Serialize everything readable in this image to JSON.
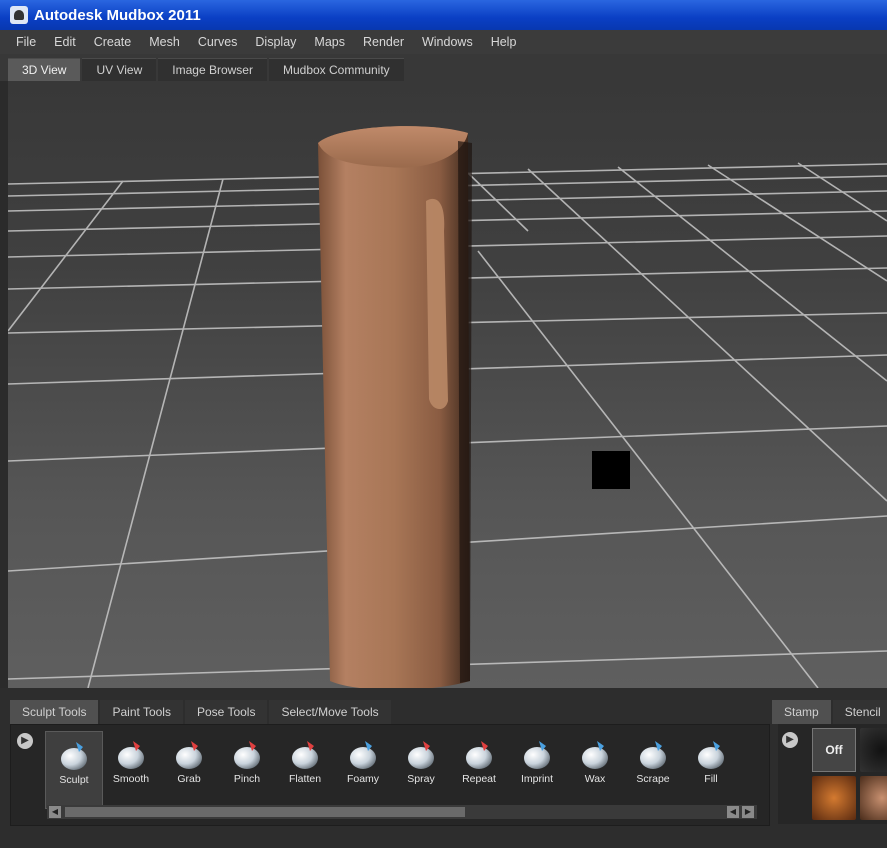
{
  "window": {
    "title": "Autodesk Mudbox 2011",
    "icon": "mudbox-app-icon"
  },
  "menu": [
    "File",
    "Edit",
    "Create",
    "Mesh",
    "Curves",
    "Display",
    "Maps",
    "Render",
    "Windows",
    "Help"
  ],
  "view_tabs": {
    "items": [
      "3D View",
      "UV View",
      "Image Browser",
      "Mudbox Community"
    ],
    "active": "3D View"
  },
  "tool_tabs": {
    "items": [
      "Sculpt Tools",
      "Paint Tools",
      "Pose Tools",
      "Select/Move Tools"
    ],
    "active": "Sculpt Tools"
  },
  "tools": [
    {
      "label": "Sculpt",
      "icon": "sculpt-brush-icon",
      "active": true
    },
    {
      "label": "Smooth",
      "icon": "smooth-brush-icon"
    },
    {
      "label": "Grab",
      "icon": "grab-brush-icon"
    },
    {
      "label": "Pinch",
      "icon": "pinch-brush-icon"
    },
    {
      "label": "Flatten",
      "icon": "flatten-brush-icon"
    },
    {
      "label": "Foamy",
      "icon": "foamy-brush-icon"
    },
    {
      "label": "Spray",
      "icon": "spray-brush-icon"
    },
    {
      "label": "Repeat",
      "icon": "repeat-brush-icon"
    },
    {
      "label": "Imprint",
      "icon": "imprint-brush-icon"
    },
    {
      "label": "Wax",
      "icon": "wax-brush-icon"
    },
    {
      "label": "Scrape",
      "icon": "scrape-brush-icon"
    },
    {
      "label": "Fill",
      "icon": "fill-brush-icon"
    }
  ],
  "stamp_tabs": {
    "items": [
      "Stamp",
      "Stencil"
    ],
    "active": "Stamp"
  },
  "stamp": {
    "off_label": "Off"
  },
  "colors": {
    "title_bar": "#0a3fc4",
    "mesh": "#a87656",
    "grid": "#c8c8c8",
    "accent": "#4aa0e0"
  }
}
